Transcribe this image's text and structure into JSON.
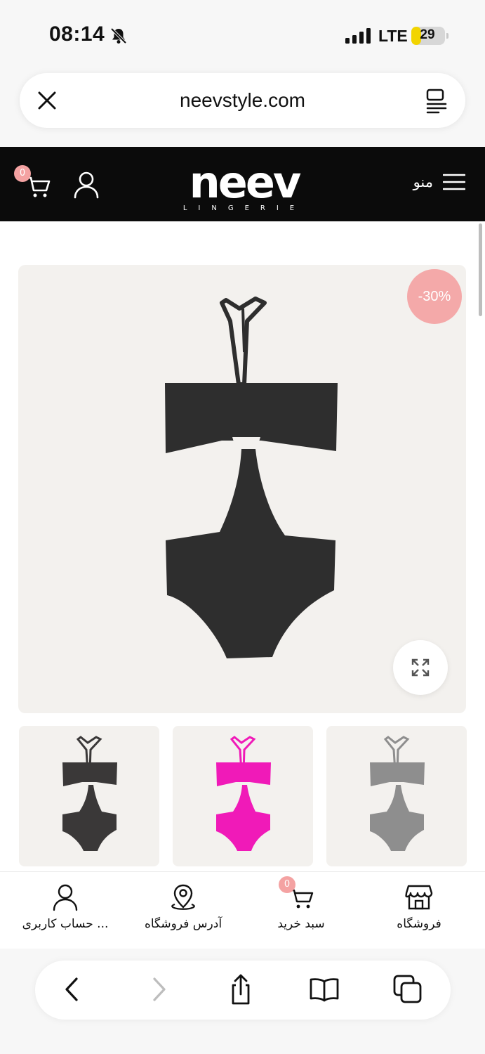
{
  "status_bar": {
    "time": "08:14",
    "network": "LTE",
    "battery": "29",
    "battery_level": 0.29
  },
  "browser": {
    "url": "neevstyle.com",
    "close_icon": "close-icon",
    "reader_icon": "reader-mode-icon"
  },
  "header": {
    "menu_label": "منو",
    "logo_text": "neev",
    "logo_sub": "LINGERIE",
    "cart_count": "0"
  },
  "product": {
    "discount_badge": "-30%",
    "main_color": "#2e2e2e",
    "thumbnails": [
      {
        "color": "#3a3838"
      },
      {
        "color": "#f01ab8"
      },
      {
        "color": "#8e8e8e"
      }
    ]
  },
  "bottom_nav": {
    "items": [
      {
        "label": "فروشگاه",
        "icon": "store-icon"
      },
      {
        "label": "سبد خرید",
        "icon": "cart-icon",
        "badge": "0"
      },
      {
        "label": "آدرس فروشگاه",
        "icon": "location-icon"
      },
      {
        "label": "حساب کاربری ...",
        "icon": "user-icon"
      }
    ]
  },
  "colors": {
    "header_bg": "#0b0b0b",
    "accent_pink": "#f4a9a9"
  }
}
